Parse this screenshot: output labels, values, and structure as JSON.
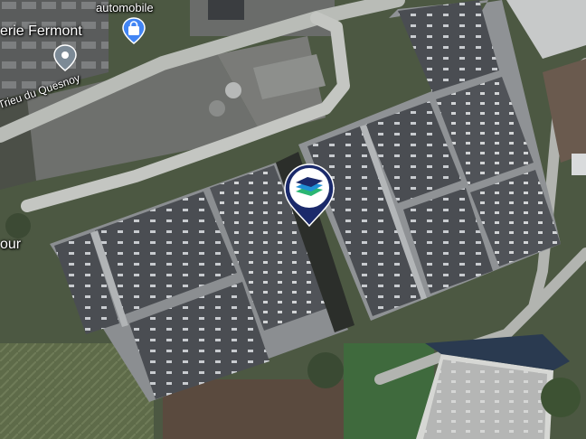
{
  "map": {
    "view": "satellite",
    "labels": {
      "place_top": "automobile",
      "place_left": "erie Fermont",
      "street": "Trieu du Quesnoy",
      "place_edge": "our"
    },
    "pois": [
      {
        "kind": "shopping",
        "icon": "shopping-bag-icon",
        "color": "#4285f4"
      },
      {
        "kind": "place",
        "icon": "location-pin-icon",
        "color": "#7c8a96"
      }
    ],
    "marker": {
      "icon": "layers-logo-icon",
      "color": "#1b2a6b"
    }
  }
}
